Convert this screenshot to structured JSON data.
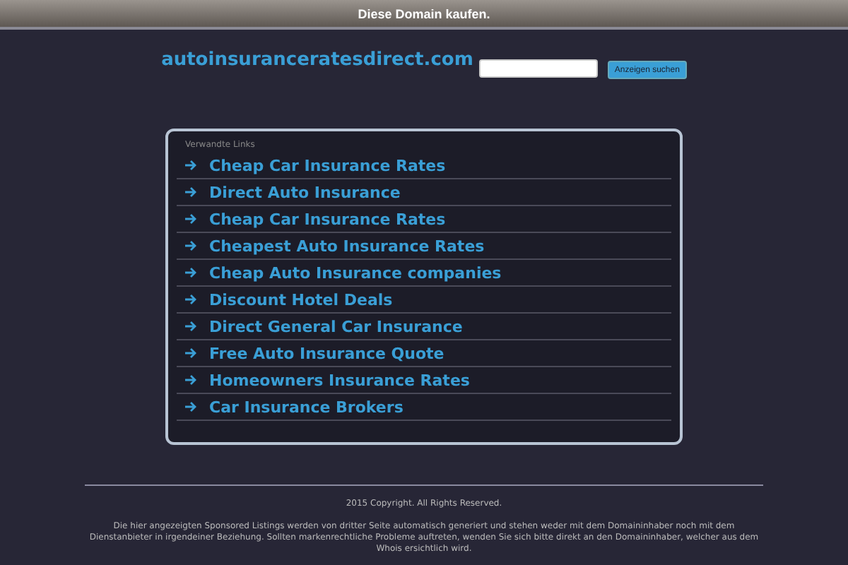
{
  "top_bar": {
    "text": "Diese Domain kaufen."
  },
  "header": {
    "domain": "autoinsuranceratesdirect.com",
    "button": "Anzeigen suchen"
  },
  "related": {
    "heading": "Verwandte Links",
    "links": [
      "Cheap Car Insurance Rates",
      "Direct Auto Insurance",
      "Cheap Car Insurance Rates",
      "Cheapest Auto Insurance Rates",
      "Cheap Auto Insurance companies",
      "Discount Hotel Deals",
      "Direct General Car Insurance",
      "Free Auto Insurance Quote",
      "Homeowners Insurance Rates",
      "Car Insurance Brokers"
    ]
  },
  "footer": {
    "copyright": "2015 Copyright. All Rights Reserved.",
    "disclaimer": "Die hier angezeigten Sponsored Listings werden von dritter Seite automatisch generiert und stehen weder mit dem Domaininhaber noch mit dem Dienstanbieter in irgendeiner Beziehung. Sollten markenrechtliche Probleme auftreten, wenden Sie sich bitte direkt an den Domaininhaber, welcher aus dem Whois ersichtlich wird."
  }
}
